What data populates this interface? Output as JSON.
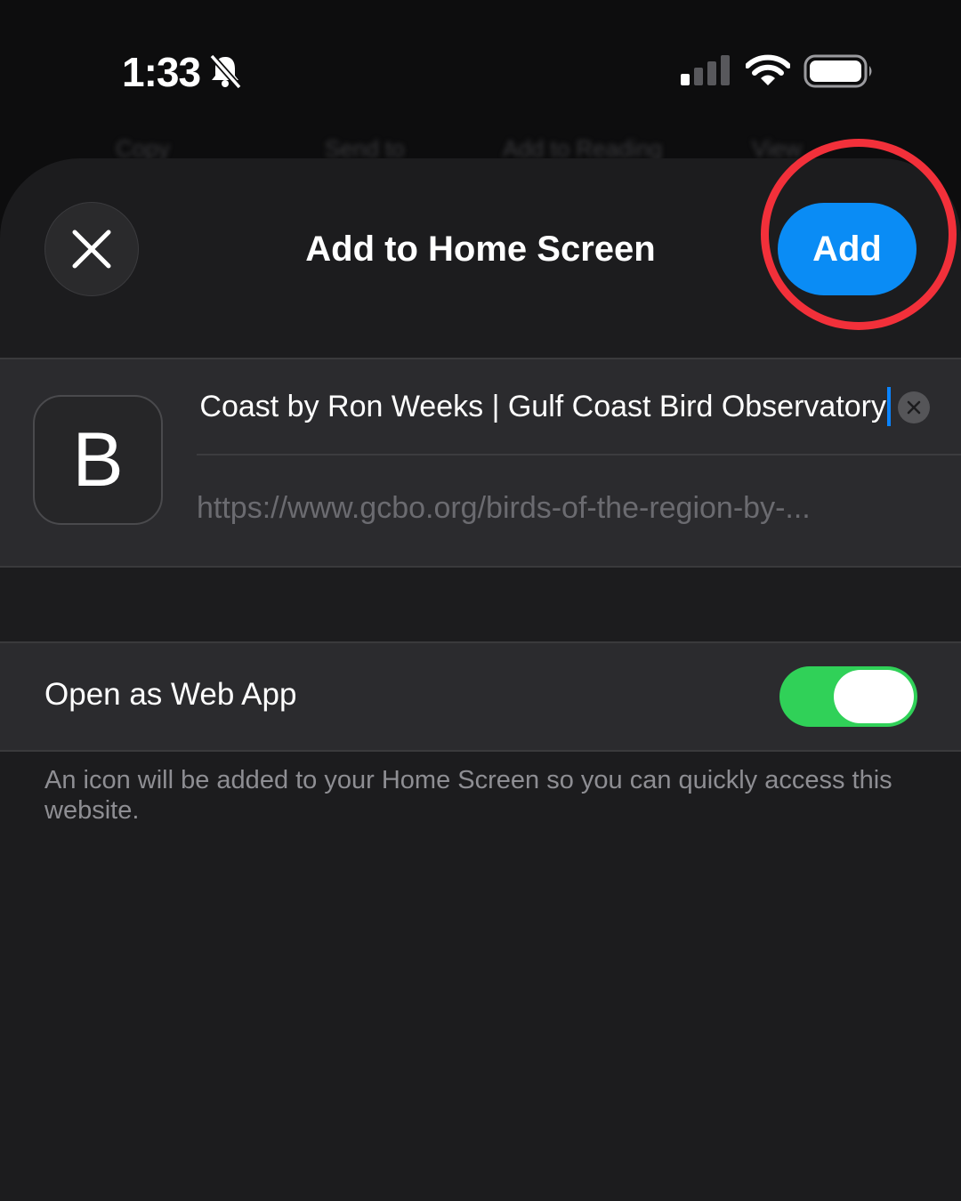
{
  "status_bar": {
    "time": "1:33",
    "icons": [
      "bell-slash-icon",
      "cellular-signal-icon",
      "wifi-icon",
      "battery-icon"
    ]
  },
  "background_menu": [
    "Copy",
    "Send to",
    "Add to Reading",
    "View"
  ],
  "sheet": {
    "title": "Add to Home Screen",
    "close_icon": "close-icon",
    "add_label": "Add",
    "accent_color": "#0a8cf5",
    "annotation_color": "#f2303a"
  },
  "bookmark": {
    "icon_letter": "B",
    "name_value": "Coast by Ron Weeks | Gulf Coast Bird Observatory",
    "url": "https://www.gcbo.org/birds-of-the-region-by-..."
  },
  "web_app": {
    "label": "Open as Web App",
    "enabled": true,
    "toggle_color": "#30d158"
  },
  "footnote": "An icon will be added to your Home Screen so you can quickly access this website."
}
